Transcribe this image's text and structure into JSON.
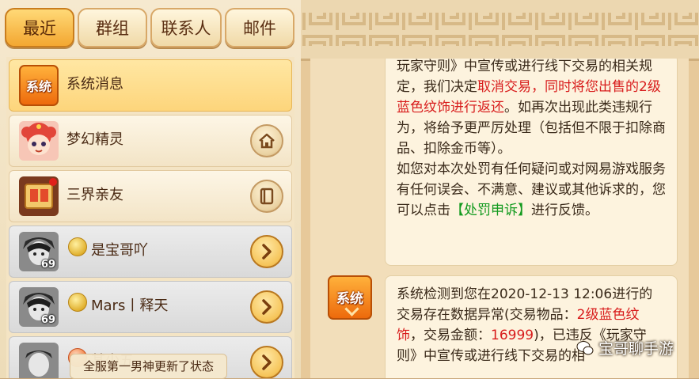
{
  "tabs": [
    {
      "label": "最近",
      "active": true
    },
    {
      "label": "群组",
      "active": false
    },
    {
      "label": "联系人",
      "active": false
    },
    {
      "label": "邮件",
      "active": false
    }
  ],
  "contacts": [
    {
      "name": "系统消息",
      "style": "selected",
      "avatar": "system-badge",
      "avatar_text": "系统"
    },
    {
      "name": "梦幻精灵",
      "style": "normal",
      "avatar": "fairy-avatar",
      "button_icon": "home-icon"
    },
    {
      "name": "三界亲友",
      "style": "normal",
      "avatar": "scroll-avatar",
      "button_icon": "book-icon"
    },
    {
      "name": "是宝哥吖",
      "style": "gray",
      "avatar": "character-avatar",
      "level": "69",
      "badge": "gold",
      "button_icon": "chevron-right-icon"
    },
    {
      "name": "Mars丨释天",
      "style": "gray",
      "avatar": "character-avatar",
      "level": "69",
      "badge": "gold",
      "button_icon": "chevron-right-icon"
    },
    {
      "name": "某少五",
      "style": "gray",
      "avatar": "character-avatar",
      "badge": "red",
      "button_icon": "chevron-right-icon"
    }
  ],
  "toast": "全服第一男神更新了状态",
  "messages": [
    {
      "sender_icon_text": "系统",
      "segments": [
        {
          "text": "玩家守则》中宣传或进行线下交易的相关规定，我们决定",
          "color": "normal"
        },
        {
          "text": "取消交易，同时将您出售的2级蓝色纹饰进行返还",
          "color": "red"
        },
        {
          "text": "。如再次出现此类违规行为，将给予更严厉处理（包括但不限于扣除商品、扣除金币等）。",
          "color": "normal"
        },
        {
          "break": true
        },
        {
          "text": "如您对本次处罚有任何疑问或对网易游戏服务有任何误会、不满意、建议或其他诉求的，您可以点击",
          "color": "normal"
        },
        {
          "text": "【处罚申诉】",
          "color": "green"
        },
        {
          "text": "进行反馈。",
          "color": "normal"
        }
      ]
    },
    {
      "sender_icon_text": "系统",
      "segments": [
        {
          "text": "系统检测到您在2020-12-13 12:06进行的交易存在数据异常(交易物品：",
          "color": "normal"
        },
        {
          "text": "2级蓝色纹饰",
          "color": "red"
        },
        {
          "text": "，交易金额：",
          "color": "normal"
        },
        {
          "text": "16999",
          "color": "red"
        },
        {
          "text": ")，已违反《玩家守则》中宣传或进行线下交易的相",
          "color": "normal"
        }
      ]
    }
  ],
  "watermark": "宝哥聊手游",
  "colors": {
    "accent": "#f3a731",
    "red_text": "#d81c1c",
    "green_text": "#129a1e"
  }
}
